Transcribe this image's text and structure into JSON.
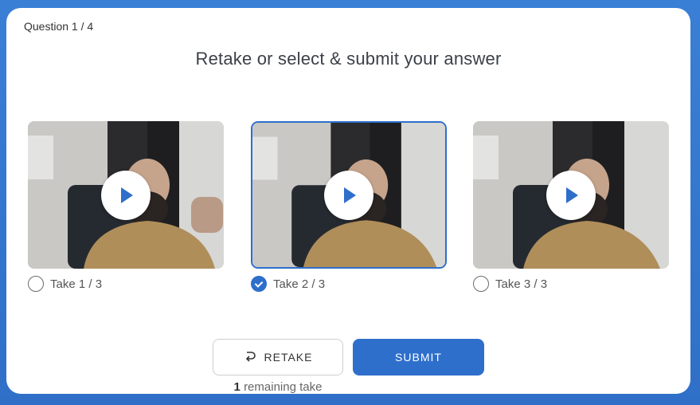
{
  "header": {
    "question_counter": "Question 1 / 4",
    "title": "Retake or select & submit your answer"
  },
  "takes": [
    {
      "label": "Take 1 / 3",
      "selected": false
    },
    {
      "label": "Take 2 / 3",
      "selected": true
    },
    {
      "label": "Take 3 / 3",
      "selected": false
    }
  ],
  "actions": {
    "retake_label": "RETAKE",
    "retake_icon": "retake-arrow-icon",
    "submit_label": "SUBMIT",
    "remaining_count": "1",
    "remaining_text": "remaining take"
  },
  "colors": {
    "accent": "#2e6fcb",
    "background": "#3a7fd6"
  }
}
